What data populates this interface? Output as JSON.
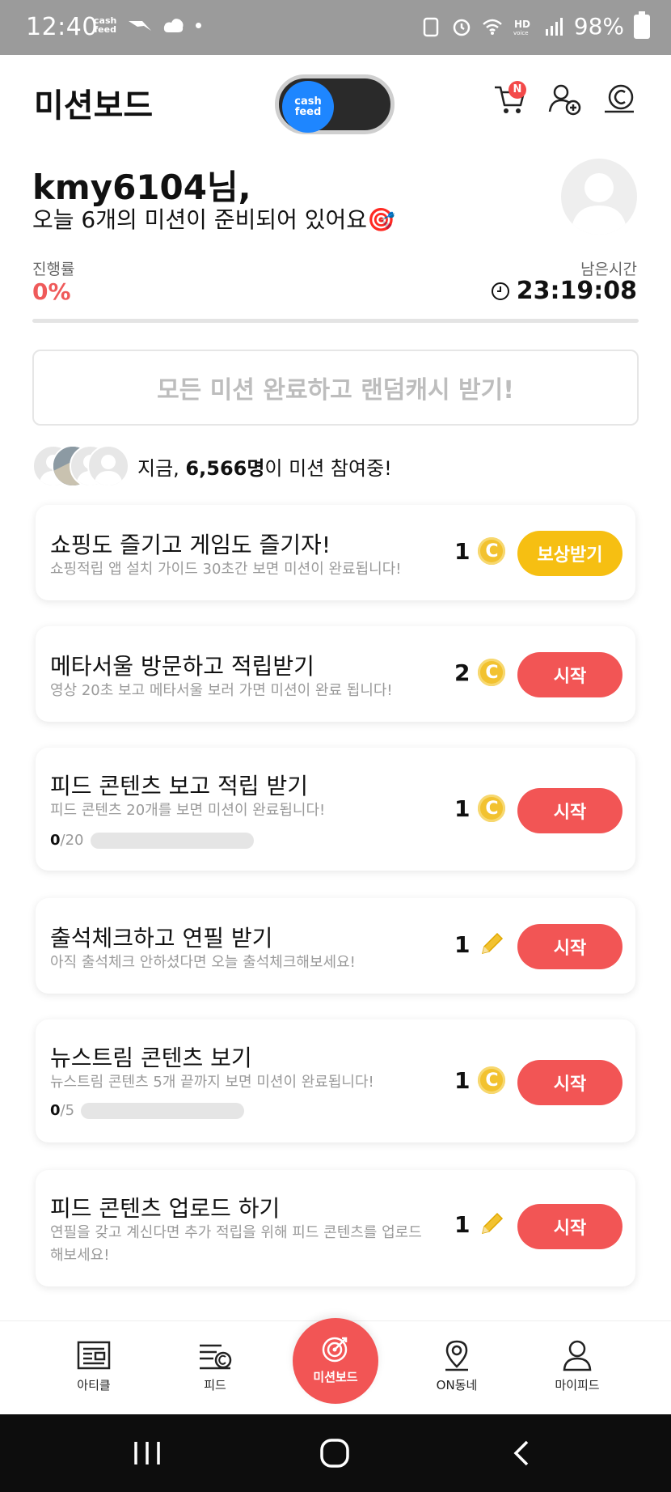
{
  "status_bar": {
    "time": "12:40",
    "left_icons": [
      "cash-feed-notification-icon",
      "bird-icon",
      "cloud-icon",
      "dot-icon"
    ],
    "battery": "98%",
    "network_label": "HD voice"
  },
  "header": {
    "title": "미션보드",
    "toggle_label": "cash feed",
    "cart_badge": "N",
    "icons": [
      "cart-icon",
      "add-friend-icon",
      "cash-icon"
    ]
  },
  "greeting": {
    "name": "kmy6104님,",
    "subtitle": "오늘 6개의 미션이 준비되어 있어요",
    "target_emoji": "🎯"
  },
  "progress": {
    "label": "진행률",
    "value": "0%",
    "fraction": 0
  },
  "remaining": {
    "label": "남은시간",
    "value": "23:19:08"
  },
  "all_missions_button": "모든 미션 완료하고 랜덤캐시 받기!",
  "participants": {
    "prefix": "지금, ",
    "count": "6,566명",
    "suffix": "이 미션 참여중!"
  },
  "missions": [
    {
      "title": "쇼핑도 즐기고 게임도 즐기자!",
      "desc": "쇼핑적립 앱 설치 가이드 30초간 보면 미션이 완료됩니다!",
      "reward": "1",
      "reward_icon": "coin-icon",
      "button": "보상받기",
      "button_color": "#f6bf12"
    },
    {
      "title": "메타서울 방문하고 적립받기",
      "desc": "영상 20초 보고 메타서울 보러 가면 미션이 완료 됩니다!",
      "reward": "2",
      "reward_icon": "coin-icon",
      "button": "시작",
      "button_color": "#f25555"
    },
    {
      "title": "피드 콘텐츠 보고 적립 받기",
      "desc": "피드 콘텐츠 20개를 보면 미션이 완료됩니다!",
      "reward": "1",
      "reward_icon": "coin-icon",
      "button": "시작",
      "button_color": "#f25555",
      "progress_current": "0",
      "progress_total": "/20",
      "progress_fraction": 0
    },
    {
      "title": "출석체크하고 연필 받기",
      "desc": "아직 출석체크 안하셨다면 오늘 출석체크해보세요!",
      "reward": "1",
      "reward_icon": "pencil-icon",
      "button": "시작",
      "button_color": "#f25555"
    },
    {
      "title": "뉴스트림 콘텐츠 보기",
      "desc": "뉴스트림 콘텐츠 5개 끝까지 보면 미션이 완료됩니다!",
      "reward": "1",
      "reward_icon": "coin-icon",
      "button": "시작",
      "button_color": "#f25555",
      "progress_current": "0",
      "progress_total": "/5",
      "progress_fraction": 0
    },
    {
      "title": "피드 콘텐츠 업로드 하기",
      "desc": "연필을 갖고 계신다면 추가 적립을 위해 피드 콘텐츠를 업로드해보세요!",
      "reward": "1",
      "reward_icon": "pencil-icon",
      "button": "시작",
      "button_color": "#f25555"
    }
  ],
  "bottom_nav": {
    "items": [
      {
        "label": "아티클",
        "icon": "article-icon"
      },
      {
        "label": "피드",
        "icon": "feed-icon"
      },
      {
        "label": "미션보드",
        "icon": "target-icon",
        "active": true
      },
      {
        "label": "ON동네",
        "icon": "location-pin-icon"
      },
      {
        "label": "마이피드",
        "icon": "person-icon"
      }
    ]
  },
  "colors": {
    "accent": "#f25555",
    "reward_button": "#f6bf12",
    "toggle_knob": "#1e86ff",
    "progress_text": "#ef5a5a"
  }
}
